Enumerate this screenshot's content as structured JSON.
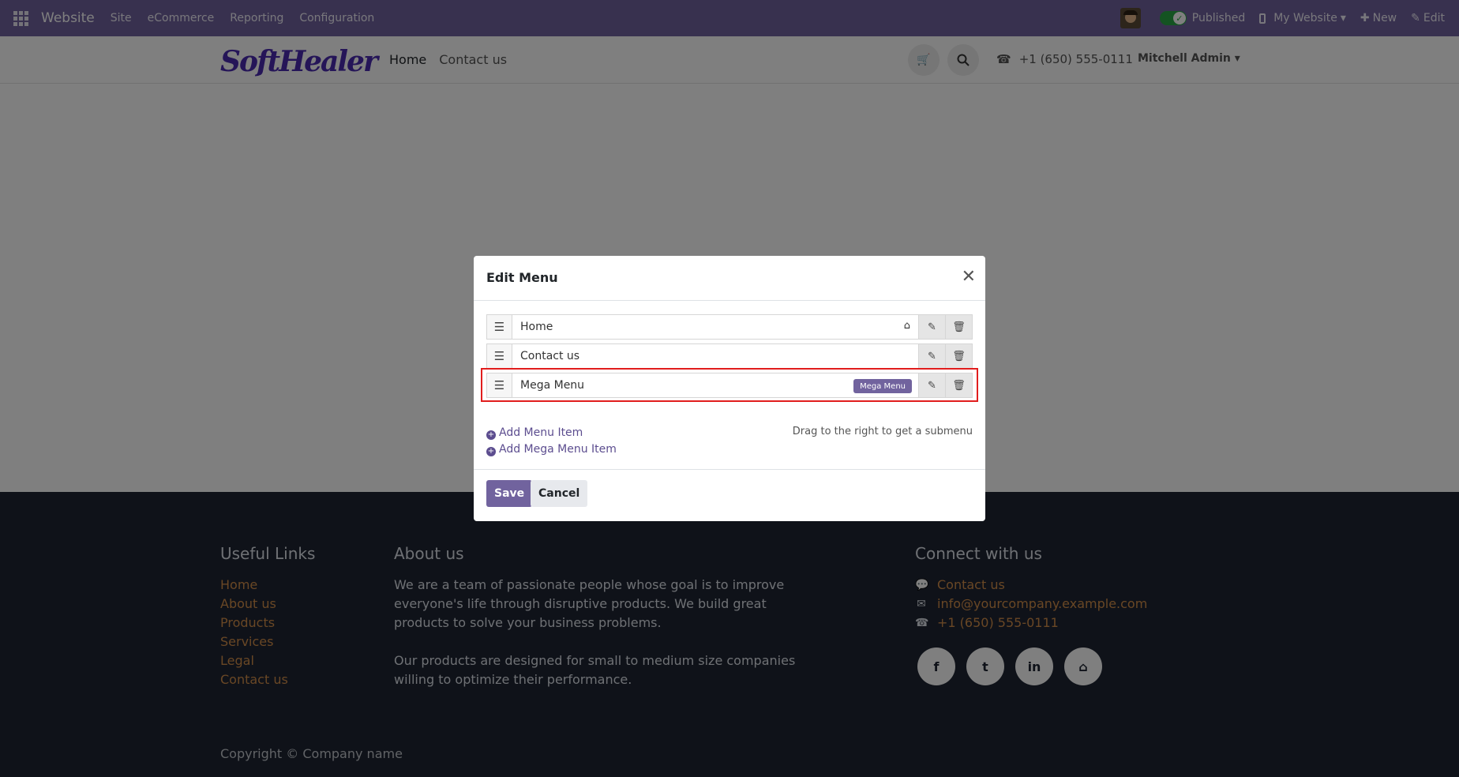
{
  "admin_bar": {
    "app_name": "Website",
    "menu": [
      "Site",
      "eCommerce",
      "Reporting",
      "Configuration"
    ],
    "published_label": "Published",
    "website_label": "My Website",
    "new_label": "New",
    "edit_label": "Edit"
  },
  "site_header": {
    "logo_text": "SoftHealer",
    "nav": [
      "Home",
      "Contact us"
    ],
    "phone": "+1 (650) 555-0111",
    "user": "Mitchell Admin"
  },
  "footer": {
    "useful_links_title": "Useful Links",
    "useful_links": [
      "Home",
      "About us",
      "Products",
      "Services",
      "Legal",
      "Contact us"
    ],
    "about_title": "About us",
    "about_p1": "We are a team of passionate people whose goal is to improve everyone's life through disruptive products. We build great products to solve your business problems.",
    "about_p2": "Our products are designed for small to medium size companies willing to optimize their performance.",
    "connect_title": "Connect with us",
    "contact_us": "Contact us",
    "email": "info@yourcompany.example.com",
    "phone": "+1 (650) 555-0111",
    "copyright": "Copyright © Company name"
  },
  "modal": {
    "title": "Edit Menu",
    "items": [
      {
        "label": "Home",
        "badge": ""
      },
      {
        "label": "Contact us",
        "badge": ""
      },
      {
        "label": "Mega Menu",
        "badge": "Mega Menu"
      }
    ],
    "add_menu_item": "Add Menu Item",
    "add_mega_menu_item": "Add Mega Menu Item",
    "drag_hint": "Drag to the right to get a submenu",
    "save": "Save",
    "cancel": "Cancel"
  },
  "colors": {
    "brand_purple": "#71639e",
    "footer_bg": "#1e2532",
    "footer_link": "#d38e4a",
    "highlight": "#e11d1d"
  }
}
